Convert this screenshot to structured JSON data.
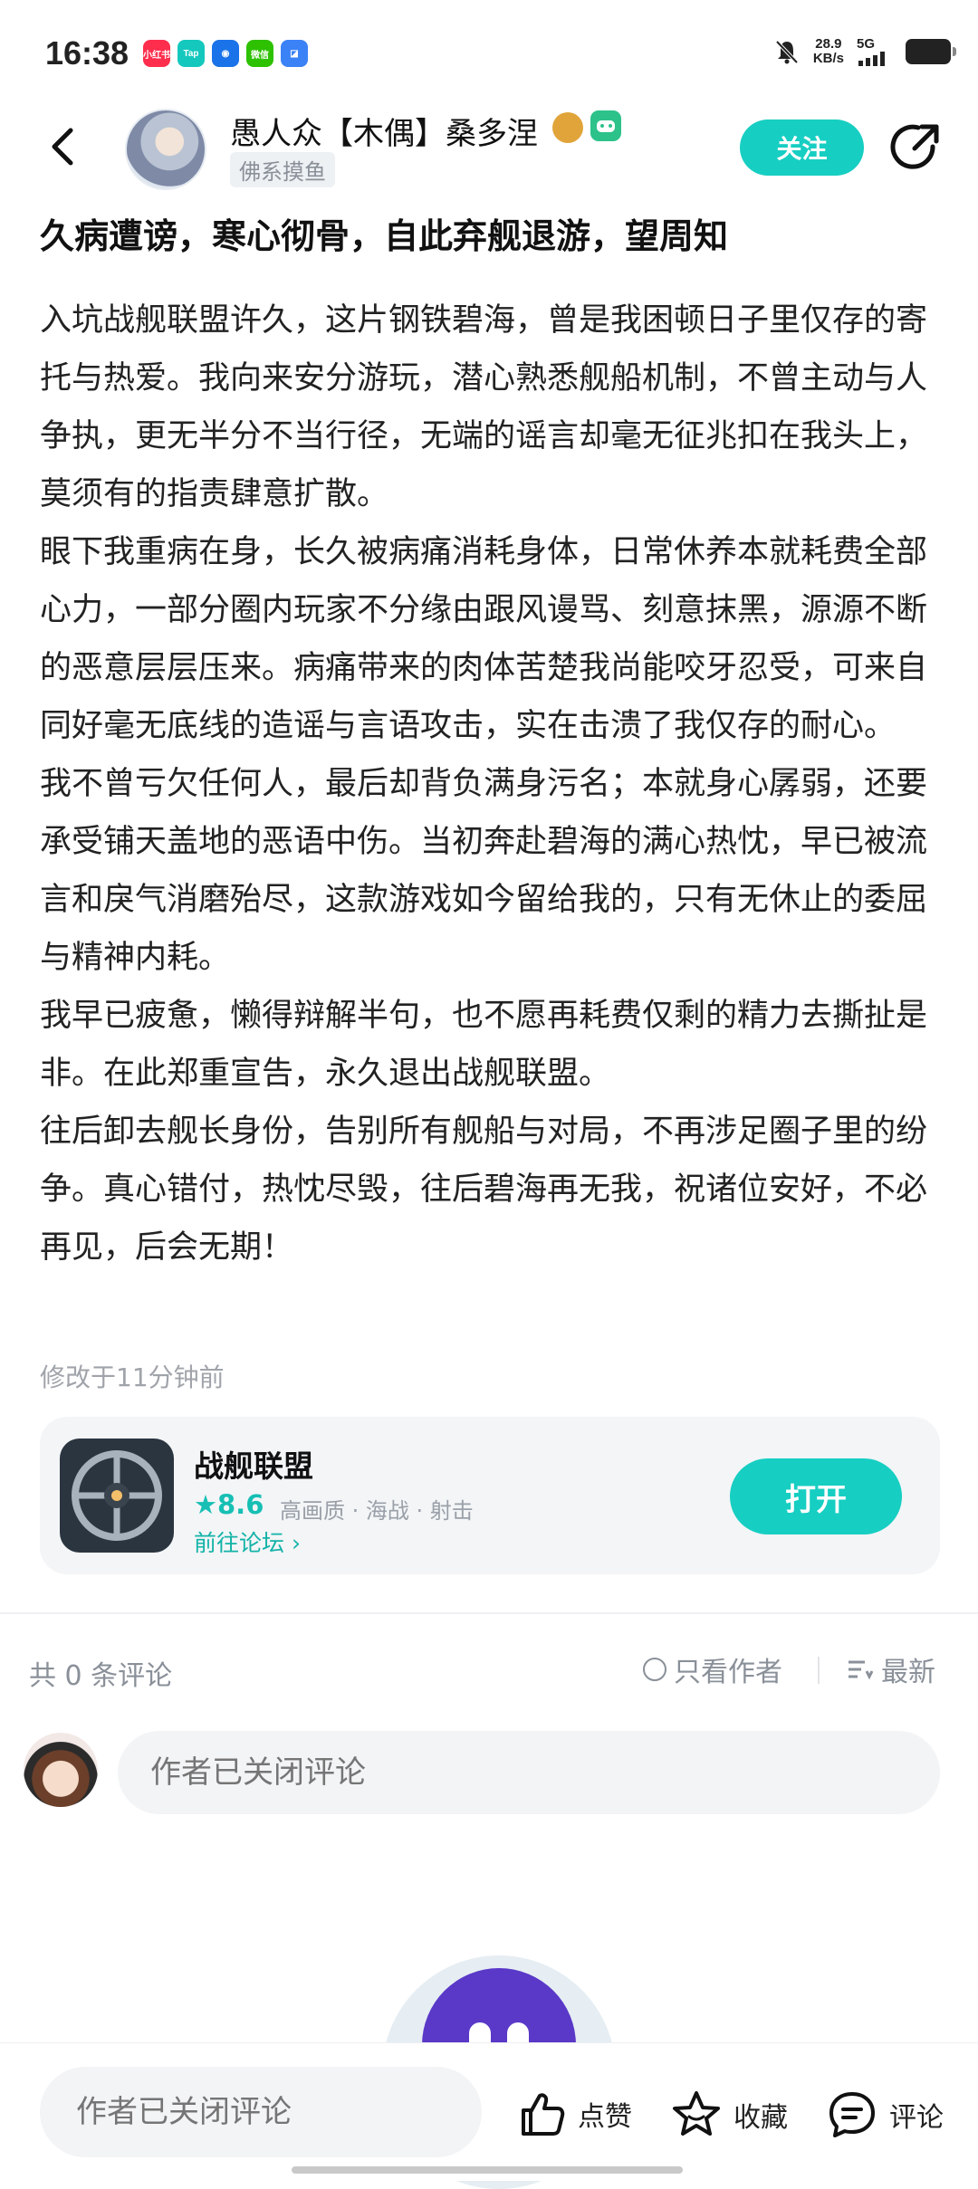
{
  "status_bar": {
    "time": "16:38",
    "apps": [
      {
        "label": "小红书",
        "color": "#ff2e4d"
      },
      {
        "label": "Tap",
        "color": "#14c8bd"
      },
      {
        "label": "◉",
        "color": "#1a73e8"
      },
      {
        "label": "微信",
        "color": "#2dc100"
      },
      {
        "label": "◪",
        "color": "#3b82f6"
      }
    ],
    "speed_value": "28.9",
    "speed_unit": "KB/s",
    "network": "5G",
    "icons": [
      "mute-bell-icon",
      "signal-icon",
      "battery-icon"
    ]
  },
  "header": {
    "username": "愚人众【木偶】桑多涅",
    "user_tag": "佛系摸鱼",
    "follow_label": "关注",
    "badges": [
      "gold-level-badge",
      "game-badge"
    ],
    "icons": [
      "back-arrow-icon",
      "share-icon"
    ]
  },
  "post": {
    "title": "久病遭谤，寒心彻骨，自此弃舰退游，望周知",
    "paragraphs": [
      "入坑战舰联盟许久，这片钢铁碧海，曾是我困顿日子里仅存的寄托与热爱。我向来安分游玩，潜心熟悉舰船机制，不曾主动与人争执，更无半分不当行径，无端的谣言却毫无征兆扣在我头上，莫须有的指责肆意扩散。",
      "眼下我重病在身，长久被病痛消耗身体，日常休养本就耗费全部心力，一部分圈内玩家不分缘由跟风谩骂、刻意抹黑，源源不断的恶意层层压来。病痛带来的肉体苦楚我尚能咬牙忍受，可来自同好毫无底线的造谣与言语攻击，实在击溃了我仅存的耐心。",
      "我不曾亏欠任何人，最后却背负满身污名；本就身心孱弱，还要承受铺天盖地的恶语中伤。当初奔赴碧海的满心热忱，早已被流言和戾气消磨殆尽，这款游戏如今留给我的，只有无休止的委屈与精神内耗。",
      "我早已疲惫，懒得辩解半句，也不愿再耗费仅剩的精力去撕扯是非。在此郑重宣告，永久退出战舰联盟。",
      "往后卸去舰长身份，告别所有舰船与对局，不再涉足圈子里的纷争。真心错付，热忱尽毁，往后碧海再无我，祝诸位安好，不必再见，后会无期！"
    ],
    "edited": "修改于11分钟前"
  },
  "game_card": {
    "name": "战舰联盟",
    "rating": "8.6",
    "tags": "高画质 · 海战 · 射击",
    "forum_link": "前往论坛 ›",
    "open_label": "打开",
    "accent": "#17cec2"
  },
  "comments": {
    "count": "共 0 条评论",
    "author_only": "只看作者",
    "sort": "最新",
    "input_placeholder": "作者已关闭评论"
  },
  "bottom_bar": {
    "input_placeholder": "作者已关闭评论",
    "like_label": "点赞",
    "favorite_label": "收藏",
    "comment_label": "评论"
  }
}
